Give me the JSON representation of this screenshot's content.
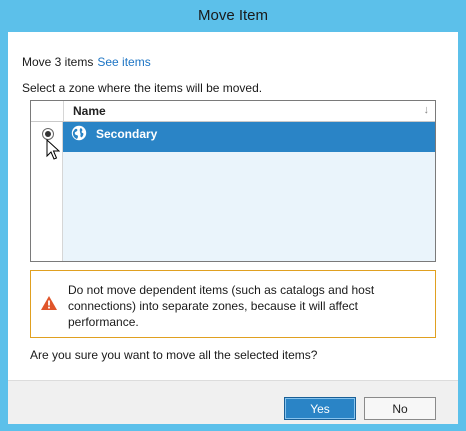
{
  "window": {
    "title": "Move Item"
  },
  "summary": {
    "move_text": "Move 3 items",
    "see_items_link": "See items"
  },
  "instruction": "Select a zone where the items will be moved.",
  "grid": {
    "column_header": "Name",
    "sort_icon": "sort-down-icon",
    "rows": [
      {
        "name": "Secondary",
        "icon": "globe-icon",
        "selected": true
      }
    ]
  },
  "warning": {
    "icon": "warning-icon",
    "text": "Do not move dependent items (such as catalogs and host connections) into separate zones, because it will affect performance."
  },
  "confirm_question": "Are you sure you want to move all the selected items?",
  "buttons": {
    "yes": "Yes",
    "no": "No"
  },
  "colors": {
    "accent": "#2a84c6",
    "title_bar": "#5cc0ea",
    "warning_border": "#e0a020",
    "warning_icon": "#e0552a"
  }
}
